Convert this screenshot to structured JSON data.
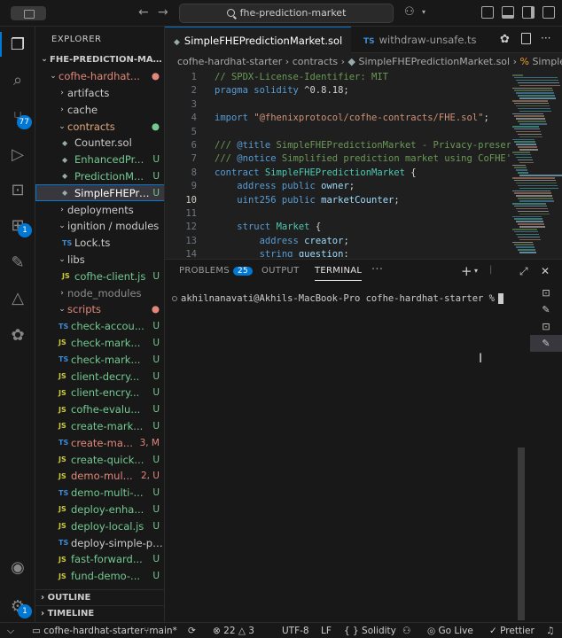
{
  "titlebar": {
    "search": "fhe-prediction-market"
  },
  "activity": {
    "source_control_badge": "77",
    "extensions_badge": "1",
    "accounts_badge": "1"
  },
  "sidebar": {
    "title": "EXPLORER",
    "items": [
      {
        "label": "FHE-PREDICTION-MARK...",
        "status": "",
        "icon": ""
      },
      {
        "label": "cofhe-hardhat...",
        "status": "",
        "icon": ""
      },
      {
        "label": "artifacts",
        "status": "",
        "icon": ""
      },
      {
        "label": "cache",
        "status": "",
        "icon": ""
      },
      {
        "label": "contracts",
        "status": "",
        "icon": ""
      },
      {
        "label": "Counter.sol",
        "status": "",
        "icon": "sol-icon"
      },
      {
        "label": "EnhancedPr...",
        "status": "U",
        "icon": "sol-icon"
      },
      {
        "label": "PredictionM...",
        "status": "U",
        "icon": "sol-icon"
      },
      {
        "label": "SimpleFHEPredic...",
        "status": "U",
        "icon": "sol-icon"
      },
      {
        "label": "deployments",
        "status": "",
        "icon": ""
      },
      {
        "label": "ignition / modules",
        "status": "",
        "icon": ""
      },
      {
        "label": "Lock.ts",
        "status": "",
        "icon": "TS"
      },
      {
        "label": "libs",
        "status": "",
        "icon": ""
      },
      {
        "label": "cofhe-client.js",
        "status": "U",
        "icon": "JS"
      },
      {
        "label": "node_modules",
        "status": "",
        "icon": ""
      },
      {
        "label": "scripts",
        "status": "",
        "icon": ""
      },
      {
        "label": "check-accou...",
        "status": "U",
        "icon": "TS"
      },
      {
        "label": "check-mark...",
        "status": "U",
        "icon": "JS"
      },
      {
        "label": "check-mark...",
        "status": "U",
        "icon": "TS"
      },
      {
        "label": "client-decry...",
        "status": "U",
        "icon": "JS"
      },
      {
        "label": "client-encry...",
        "status": "U",
        "icon": "JS"
      },
      {
        "label": "cofhe-evalu...",
        "status": "U",
        "icon": "JS"
      },
      {
        "label": "create-mark...",
        "status": "U",
        "icon": "JS"
      },
      {
        "label": "create-ma...",
        "status": "3, M",
        "icon": "TS"
      },
      {
        "label": "create-quick...",
        "status": "U",
        "icon": "JS"
      },
      {
        "label": "demo-mul...",
        "status": "2, U",
        "icon": "JS"
      },
      {
        "label": "demo-multi-...",
        "status": "U",
        "icon": "TS"
      },
      {
        "label": "deploy-enha...",
        "status": "U",
        "icon": "JS"
      },
      {
        "label": "deploy-local.js",
        "status": "U",
        "icon": "JS"
      },
      {
        "label": "deploy-simple-pr...",
        "status": "",
        "icon": "TS"
      },
      {
        "label": "fast-forward...",
        "status": "U",
        "icon": "JS"
      },
      {
        "label": "fund-demo-...",
        "status": "U",
        "icon": "JS"
      }
    ],
    "outline": "OUTLINE",
    "timeline": "TIMELINE"
  },
  "editor": {
    "tabs": [
      {
        "label": "SimpleFHEPredictionMarket.sol",
        "icon": "sol-icon"
      },
      {
        "label": "withdraw-unsafe.ts",
        "icon": "TS"
      }
    ],
    "breadcrumb": [
      "cofhe-hardhat-starter",
      "contracts",
      "SimpleFHEPredictionMarket.sol",
      "Simple"
    ],
    "lines": [
      {
        "n": "1",
        "t": "// SPDX-License-Identifier: MIT"
      },
      {
        "n": "2",
        "t": "pragma solidity ^0.8.18;"
      },
      {
        "n": "3",
        "t": ""
      },
      {
        "n": "4",
        "t": "import \"@fhenixprotocol/cofhe-contracts/FHE.sol\";"
      },
      {
        "n": "5",
        "t": ""
      },
      {
        "n": "6",
        "t": "/// @title SimpleFHEPredictionMarket - Privacy-preser"
      },
      {
        "n": "7",
        "t": "/// @notice Simplified prediction market using CoFHE'"
      },
      {
        "n": "8",
        "t": "contract SimpleFHEPredictionMarket {"
      },
      {
        "n": "9",
        "t": "    address public owner;"
      },
      {
        "n": "10",
        "t": "    uint256 public marketCounter;"
      },
      {
        "n": "11",
        "t": ""
      },
      {
        "n": "12",
        "t": "    struct Market {"
      },
      {
        "n": "13",
        "t": "        address creator;"
      },
      {
        "n": "14",
        "t": "        string question;"
      }
    ]
  },
  "panel": {
    "tabs": [
      {
        "label": "PROBLEMS",
        "badge": "25"
      },
      {
        "label": "OUTPUT",
        "badge": ""
      },
      {
        "label": "TERMINAL",
        "badge": ""
      }
    ],
    "more": "···",
    "prompt": "akhilnanavati@Akhils-MacBook-Pro cofhe-hardhat-starter %"
  },
  "statusbar": {
    "folder": "cofhe-hardhat-starter",
    "branch": "main*",
    "errors": "22",
    "warnings": "3",
    "encoding": "UTF-8",
    "eol": "LF",
    "language": "Solidity",
    "golive": "Go Live",
    "prettier": "Prettier"
  }
}
